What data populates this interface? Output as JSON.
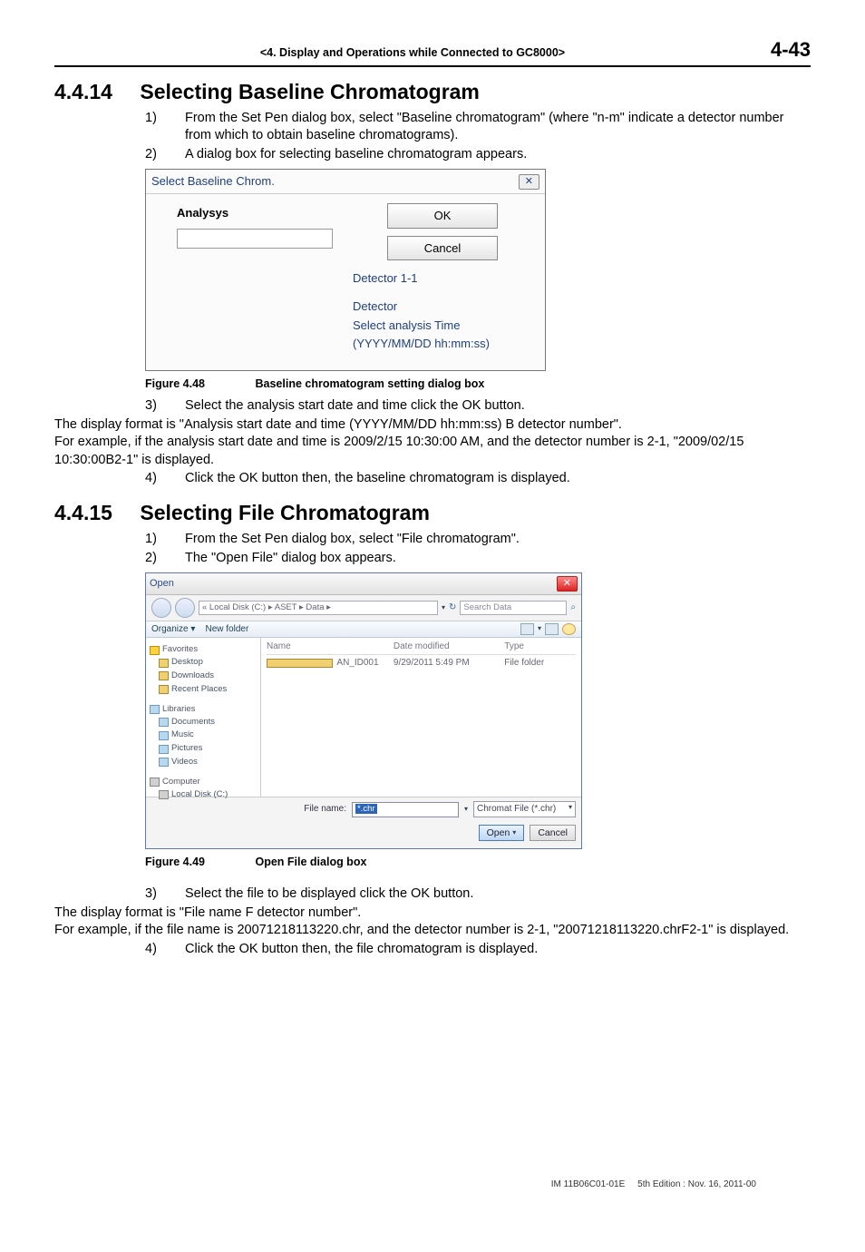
{
  "header": {
    "chapter": "<4.  Display and Operations while Connected to GC8000>",
    "page": "4-43"
  },
  "section1": {
    "num": "4.4.14",
    "title": "Selecting Baseline Chromatogram",
    "steps": {
      "s1n": "1)",
      "s1": "From the Set Pen dialog box, select \"Baseline chromatogram\" (where \"n-m\" indicate a detector number from which to obtain baseline chromatograms).",
      "s2n": "2)",
      "s2": "A dialog box for selecting baseline chromatogram appears.",
      "s3n": "3)",
      "s3": "Select the analysis start date and time click the OK button.",
      "s3a": "The display format is \"Analysis start date and time (YYYY/MM/DD hh:mm:ss) B detector number\".",
      "s3b": "For example, if the analysis start date and time is 2009/2/15 10:30:00 AM, and the detector number is 2-1, \"2009/02/15 10:30:00B2-1\" is displayed.",
      "s4n": "4)",
      "s4": "Click the OK button then, the baseline chromatogram is displayed."
    },
    "dialog": {
      "title": "Select Baseline Chrom.",
      "label": "Analysys",
      "ok": "OK",
      "cancel": "Cancel",
      "info1": "Detector 1-1",
      "info2": "Detector",
      "info3": "Select analysis Time",
      "info4": "(YYYY/MM/DD hh:mm:ss)"
    },
    "figcaption": {
      "num": "Figure 4.48",
      "txt": "Baseline chromatogram setting dialog box"
    }
  },
  "section2": {
    "num": "4.4.15",
    "title": "Selecting File Chromatogram",
    "steps": {
      "s1n": "1)",
      "s1": "From the Set Pen dialog box, select \"File chromatogram\".",
      "s2n": "2)",
      "s2": "The \"Open File\" dialog box appears.",
      "s3n": "3)",
      "s3": "Select the file to be displayed click the OK button.",
      "s3a": "The display format is \"File name F detector number\".",
      "s3b": "For example, if the file name is 20071218113220.chr, and the detector number is 2-1, \"20071218113220.chrF2-1\" is displayed.",
      "s4n": "4)",
      "s4": "Click the OK button then, the file chromatogram is displayed."
    },
    "dialog": {
      "title": "Open",
      "breadcrumb": "« Local Disk (C:) ▸ ASET ▸ Data ▸",
      "search": "Search Data",
      "organize": "Organize ▾",
      "newfolder": "New folder",
      "cols": {
        "name": "Name",
        "date": "Date modified",
        "type": "Type"
      },
      "row": {
        "name": "AN_ID001",
        "date": "9/29/2011 5:49 PM",
        "type": "File folder"
      },
      "sidebar": {
        "fav": "Favorites",
        "desktop": "Desktop",
        "downloads": "Downloads",
        "recent": "Recent Places",
        "lib": "Libraries",
        "docs": "Documents",
        "music": "Music",
        "pics": "Pictures",
        "videos": "Videos",
        "comp": "Computer",
        "localc": "Local Disk (C:)"
      },
      "fnlabel": "File name:",
      "fnvalue": "*.chr",
      "typefilter": "Chromat File (*.chr)",
      "open": "Open",
      "cancel": "Cancel"
    },
    "figcaption": {
      "num": "Figure 4.49",
      "txt": "Open File dialog box"
    }
  },
  "footer": {
    "doc": "IM 11B06C01-01E",
    "edition": "5th Edition : Nov. 16, 2011-00"
  }
}
